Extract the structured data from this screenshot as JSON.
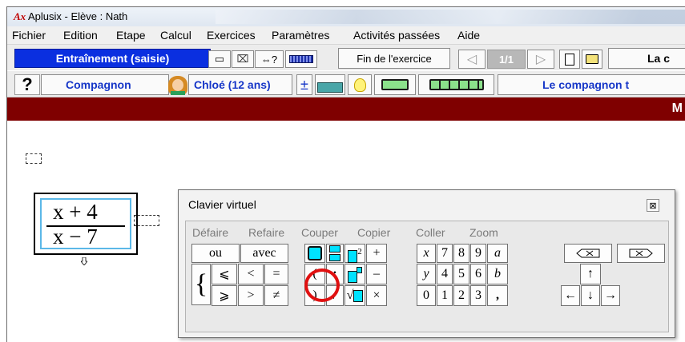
{
  "window": {
    "logo": "Ax",
    "title": "Aplusix - Elève : Nath"
  },
  "menu": [
    "Fichier",
    "Edition",
    "Etape",
    "Calcul",
    "Exercices",
    "Paramètres",
    "Activités passées",
    "Aide"
  ],
  "toolbar1": {
    "mode": "Entraînement (saisie)",
    "btn_rect": "▭",
    "btn_cross": "⌧",
    "btn_equiv": "⇔?",
    "finish": "Fin de l'exercice",
    "prev": "◁",
    "page": "1/1",
    "next": "▷",
    "new_doc": "🗋",
    "open": "🗁",
    "right_text": "La c"
  },
  "toolbar2": {
    "help": "?",
    "companion_label": "Compagnon",
    "companion_name": "Chloé (12 ans)",
    "plus_minus": "±",
    "right_text": "Le compagnon t"
  },
  "redbar": {
    "text": "M"
  },
  "formula": {
    "numerator": "x + 4",
    "denominator": "x − 7"
  },
  "keyboard": {
    "title": "Clavier virtuel",
    "close": "⊠",
    "menu": [
      "Défaire",
      "Refaire",
      "Couper",
      "Copier",
      "Coller",
      "Zoom"
    ],
    "keys": {
      "ou": "ou",
      "avec": "avec",
      "brace": "{",
      "le": "⩽",
      "lt": "<",
      "eq": "=",
      "ge": "⩾",
      "gt": ">",
      "ne": "≠",
      "plus": "+",
      "minus": "–",
      "times": "×",
      "paren_open": "(",
      "paren_close": ")",
      "colon": ":",
      "slash": "/",
      "x": "x",
      "y": "y",
      "zero": "0",
      "one": "1",
      "two": "2",
      "three": "3",
      "four": "4",
      "five": "5",
      "six": "6",
      "seven": "7",
      "eight": "8",
      "nine": "9",
      "a": "a",
      "b": "b",
      "comma": ",",
      "up": "↑",
      "down": "↓",
      "left": "←",
      "right": "→",
      "sup2": "2"
    }
  },
  "colors": {
    "mode_blue": "#0a2fe0",
    "redbar": "#7f0000",
    "highlight": "#e01010",
    "formula_border": "#5bb8e8"
  }
}
